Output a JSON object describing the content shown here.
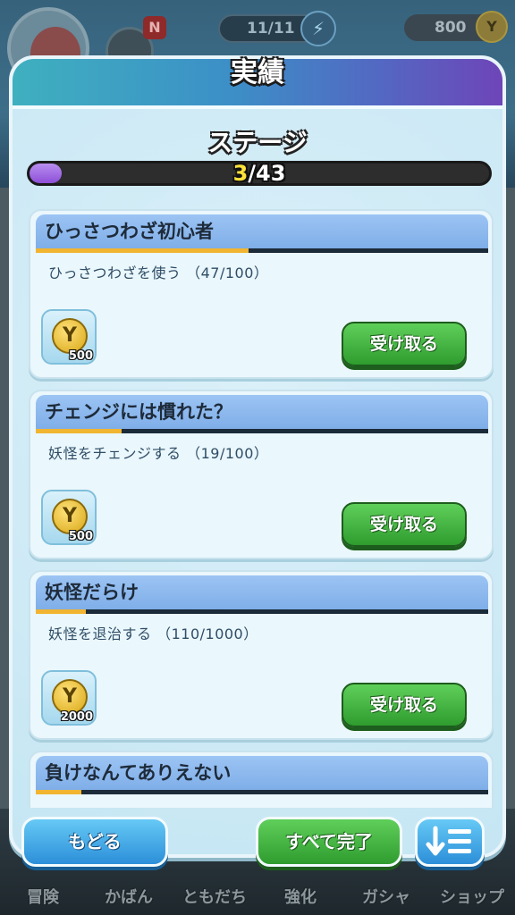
{
  "hud": {
    "notification_badge": "N",
    "stamina": "11/11",
    "money": "800",
    "coin_symbol": "Y"
  },
  "bottom_nav": [
    {
      "label": "冒険"
    },
    {
      "label": "かばん"
    },
    {
      "label": "ともだち"
    },
    {
      "label": "強化"
    },
    {
      "label": "ガシャ"
    },
    {
      "label": "ショップ"
    }
  ],
  "dialog": {
    "title": "実績",
    "section_title": "ステージ",
    "progress": {
      "current": "3",
      "total": "/43",
      "fraction": 0.07
    },
    "achievements": [
      {
        "title": "ひっさつわざ初心者",
        "description": "ひっさつわざを使う （47/100）",
        "progress": 0.47,
        "reward_amount": "500",
        "claim_label": "受け取る"
      },
      {
        "title": "チェンジには慣れた？",
        "description": "妖怪をチェンジする （19/100）",
        "progress": 0.19,
        "reward_amount": "500",
        "claim_label": "受け取る"
      },
      {
        "title": "妖怪だらけ",
        "description": "妖怪を退治する （110/1000）",
        "progress": 0.11,
        "reward_amount": "2000",
        "claim_label": "受け取る"
      },
      {
        "title": "負けなんてありえない",
        "description": "",
        "progress": 0.1,
        "reward_amount": "",
        "claim_label": ""
      }
    ],
    "buttons": {
      "back": "もどる",
      "complete_all": "すべて完了",
      "sort_icon": "sort-icon"
    }
  }
}
